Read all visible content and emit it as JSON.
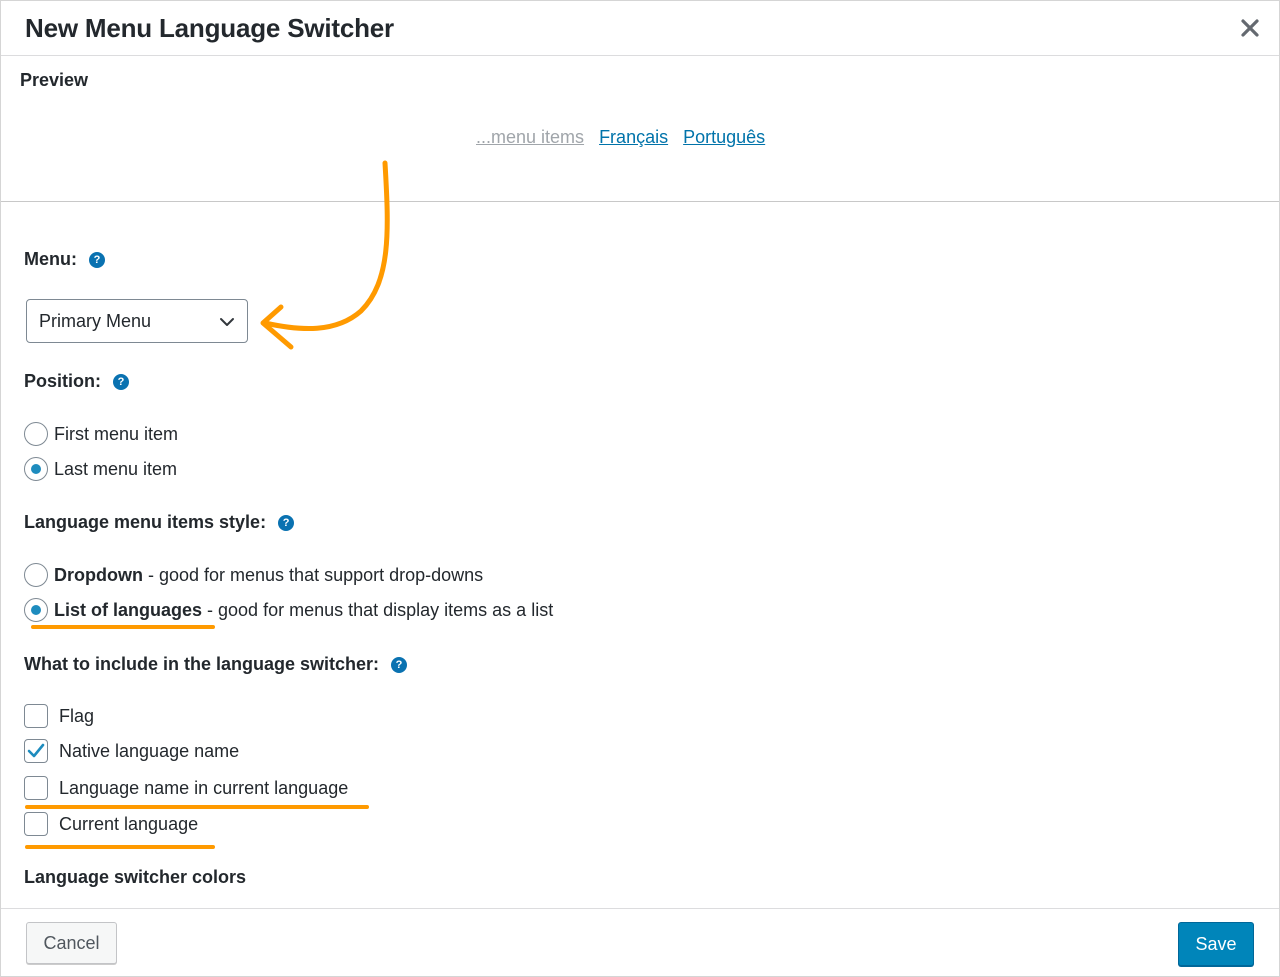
{
  "dialog": {
    "title": "New Menu Language Switcher"
  },
  "preview": {
    "label": "Preview",
    "placeholder_link": "...menu items",
    "languages": [
      "Français",
      "Português"
    ]
  },
  "menu": {
    "label": "Menu:",
    "selected": "Primary Menu"
  },
  "position": {
    "label": "Position:",
    "options": [
      {
        "label": "First menu item",
        "checked": false
      },
      {
        "label": "Last menu item",
        "checked": true
      }
    ]
  },
  "style": {
    "label": "Language menu items style:",
    "options": [
      {
        "title": "Dropdown",
        "desc": " - good for menus that support drop-downs",
        "checked": false
      },
      {
        "title": "List of languages",
        "desc": " - good for menus that display items as a list",
        "checked": true
      }
    ]
  },
  "include": {
    "label": "What to include in the language switcher:",
    "options": [
      {
        "label": "Flag",
        "checked": false
      },
      {
        "label": "Native language name",
        "checked": true
      },
      {
        "label": "Language name in current language",
        "checked": false
      },
      {
        "label": "Current language",
        "checked": false
      }
    ]
  },
  "colors": {
    "label": "Language switcher colors"
  },
  "footer": {
    "cancel_label": "Cancel",
    "save_label": "Save"
  },
  "theme": {
    "accent": "#0085ba",
    "link": "#0073aa",
    "annotation": "#ff9a00"
  }
}
